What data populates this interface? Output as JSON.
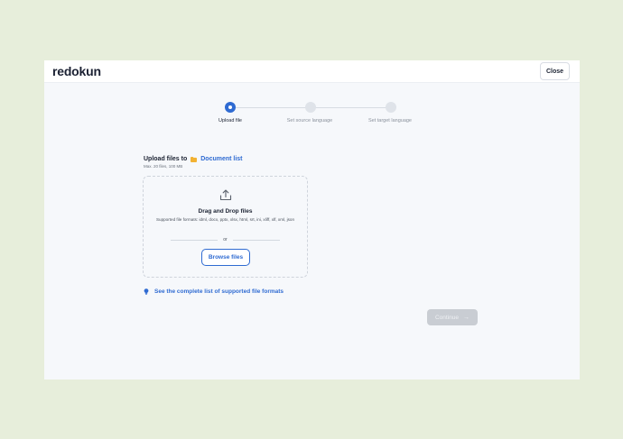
{
  "header": {
    "logo_text": "redokun",
    "close_label": "Close"
  },
  "stepper": {
    "steps": [
      {
        "label": "Upload file",
        "state": "active"
      },
      {
        "label": "Set source language",
        "state": "inactive"
      },
      {
        "label": "Set target language",
        "state": "inactive"
      }
    ]
  },
  "upload": {
    "title_prefix": "Upload files to",
    "folder_link": "Document list",
    "limits": "Max. 20 files, 100 MB",
    "dropzone_title": "Drag and Drop files",
    "formats_text": "Supported file formats: idml, docx, pptx, xlsx, html, srt, ini, xliff, xlf, xml, json",
    "or_text": "or",
    "browse_label": "Browse files"
  },
  "formats_link": "See the complete list of supported file formats",
  "continue_label": "Continue",
  "colors": {
    "accent": "#2f6bd2",
    "folder": "#f2b233",
    "disabled": "#c9cdd3",
    "background": "#e7eedb"
  },
  "icons": [
    "upload-icon",
    "folder-icon",
    "lightbulb-icon",
    "arrow-right-icon"
  ]
}
